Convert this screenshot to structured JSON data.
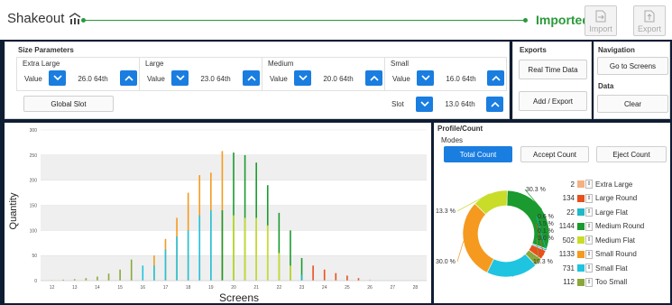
{
  "app": {
    "title": "Shakeout",
    "status": "Imported",
    "import_label": "Import",
    "export_label": "Export"
  },
  "size_params": {
    "title": "Size Parameters",
    "value_label": "Value",
    "groups": [
      {
        "name": "Extra Large",
        "value": "26.0 64th"
      },
      {
        "name": "Large",
        "value": "23.0 64th"
      },
      {
        "name": "Medium",
        "value": "20.0 64th"
      },
      {
        "name": "Small",
        "value": "16.0 64th"
      }
    ],
    "global_slot_label": "Global Slot",
    "slot_label": "Slot",
    "slot_value": "13.0 64th"
  },
  "exports": {
    "title": "Exports",
    "real_time_label": "Real Time Data",
    "add_export_label": "Add / Export"
  },
  "navigation": {
    "title": "Navigation",
    "go_to_screens_label": "Go to Screens"
  },
  "data_section": {
    "title": "Data",
    "clear_label": "Clear"
  },
  "profile": {
    "title": "Profile/Count",
    "modes_label": "Modes",
    "modes": [
      "Total Count",
      "Accept Count",
      "Eject Count"
    ],
    "active_mode": "Total Count",
    "legend": [
      {
        "count": "2",
        "label": "Extra Large",
        "color": "#f4b183"
      },
      {
        "count": "134",
        "label": "Large Round",
        "color": "#e8501e"
      },
      {
        "count": "22",
        "label": "Large Flat",
        "color": "#1fb8c8"
      },
      {
        "count": "1144",
        "label": "Medium Round",
        "color": "#1a9a2f"
      },
      {
        "count": "502",
        "label": "Medium Flat",
        "color": "#c9dc2a"
      },
      {
        "count": "1133",
        "label": "Small Round",
        "color": "#f59a1e"
      },
      {
        "count": "731",
        "label": "Small Flat",
        "color": "#1fc4e0"
      },
      {
        "count": "112",
        "label": "Too Small",
        "color": "#8aa83a"
      }
    ]
  },
  "chart_data": [
    {
      "type": "bar",
      "xlabel": "Screens",
      "ylabel": "Quantity",
      "xlim": [
        11.5,
        28.5
      ],
      "ylim": [
        0,
        300
      ],
      "yticks": [
        0,
        50,
        100,
        150,
        200,
        250,
        300
      ],
      "xticks": [
        12,
        13,
        14,
        15,
        16,
        17,
        18,
        19,
        20,
        21,
        22,
        23,
        24,
        25,
        26,
        27,
        28
      ],
      "grid": true,
      "bars": [
        {
          "x": 12.0,
          "y": 1,
          "color": "#8aa83a"
        },
        {
          "x": 12.5,
          "y": 2,
          "color": "#8aa83a"
        },
        {
          "x": 13.0,
          "y": 3,
          "color": "#8aa83a"
        },
        {
          "x": 13.5,
          "y": 5,
          "color": "#8aa83a"
        },
        {
          "x": 14.0,
          "y": 8,
          "color": "#8aa83a"
        },
        {
          "x": 14.5,
          "y": 14,
          "color": "#8aa83a"
        },
        {
          "x": 15.0,
          "y": 22,
          "color": "#8aa83a"
        },
        {
          "x": 15.5,
          "y": 42,
          "color": "#8aa83a"
        },
        {
          "x": 16.0,
          "y": 30,
          "color": "#1fc4e0"
        },
        {
          "x": 16.5,
          "y": 50,
          "color": "#f59a1e"
        },
        {
          "x": 16.5,
          "y": 30,
          "color": "#1fc4e0"
        },
        {
          "x": 17.0,
          "y": 83,
          "color": "#f59a1e"
        },
        {
          "x": 17.0,
          "y": 62,
          "color": "#1fc4e0"
        },
        {
          "x": 17.5,
          "y": 125,
          "color": "#f59a1e"
        },
        {
          "x": 17.5,
          "y": 88,
          "color": "#1fc4e0"
        },
        {
          "x": 18.0,
          "y": 175,
          "color": "#f59a1e"
        },
        {
          "x": 18.0,
          "y": 100,
          "color": "#1fc4e0"
        },
        {
          "x": 18.5,
          "y": 210,
          "color": "#f59a1e"
        },
        {
          "x": 18.5,
          "y": 130,
          "color": "#1fc4e0"
        },
        {
          "x": 19.0,
          "y": 215,
          "color": "#f59a1e"
        },
        {
          "x": 19.0,
          "y": 140,
          "color": "#1fc4e0"
        },
        {
          "x": 19.5,
          "y": 258,
          "color": "#f59a1e"
        },
        {
          "x": 19.5,
          "y": 140,
          "color": "#1a9a2f"
        },
        {
          "x": 20.0,
          "y": 255,
          "color": "#1a9a2f"
        },
        {
          "x": 20.0,
          "y": 130,
          "color": "#c9dc2a"
        },
        {
          "x": 20.5,
          "y": 250,
          "color": "#1a9a2f"
        },
        {
          "x": 20.5,
          "y": 125,
          "color": "#c9dc2a"
        },
        {
          "x": 21.0,
          "y": 235,
          "color": "#1a9a2f"
        },
        {
          "x": 21.0,
          "y": 125,
          "color": "#c9dc2a"
        },
        {
          "x": 21.5,
          "y": 190,
          "color": "#1a9a2f"
        },
        {
          "x": 21.5,
          "y": 110,
          "color": "#c9dc2a"
        },
        {
          "x": 22.0,
          "y": 135,
          "color": "#1a9a2f"
        },
        {
          "x": 22.0,
          "y": 55,
          "color": "#c9dc2a"
        },
        {
          "x": 22.5,
          "y": 100,
          "color": "#1a9a2f"
        },
        {
          "x": 22.5,
          "y": 30,
          "color": "#c9dc2a"
        },
        {
          "x": 23.0,
          "y": 45,
          "color": "#1a9a2f"
        },
        {
          "x": 23.0,
          "y": 12,
          "color": "#1fb8c8"
        },
        {
          "x": 23.5,
          "y": 30,
          "color": "#e8501e"
        },
        {
          "x": 24.0,
          "y": 22,
          "color": "#e8501e"
        },
        {
          "x": 24.5,
          "y": 15,
          "color": "#e8501e"
        },
        {
          "x": 25.0,
          "y": 10,
          "color": "#e8501e"
        },
        {
          "x": 25.5,
          "y": 5,
          "color": "#e8501e"
        },
        {
          "x": 26.0,
          "y": 2,
          "color": "#f4b183"
        }
      ]
    },
    {
      "type": "pie",
      "donut": true,
      "slices": [
        {
          "label": "Extra Large",
          "value": 0.1,
          "text": "",
          "color": "#f4b183"
        },
        {
          "label": "Large Round",
          "value": 3.5,
          "text": "3.5 %",
          "color": "#e8501e"
        },
        {
          "label": "Large Flat",
          "value": 0.6,
          "text": "0.6 %",
          "color": "#1fb8c8"
        },
        {
          "label": "Medium Round",
          "value": 30.3,
          "text": "30.3 %",
          "color": "#1a9a2f"
        },
        {
          "label": "Medium Flat",
          "value": 13.3,
          "text": "13.3 %",
          "color": "#c9dc2a"
        },
        {
          "label": "Small Round",
          "value": 30.0,
          "text": "30.0 %",
          "color": "#f59a1e"
        },
        {
          "label": "Small Flat",
          "value": 19.3,
          "text": "19.3 %",
          "color": "#1fc4e0"
        },
        {
          "label": "Too Small",
          "value": 3.0,
          "text": "3.0 %",
          "color": "#8aa83a"
        }
      ],
      "extra_labels": [
        "0.1 %"
      ]
    }
  ]
}
